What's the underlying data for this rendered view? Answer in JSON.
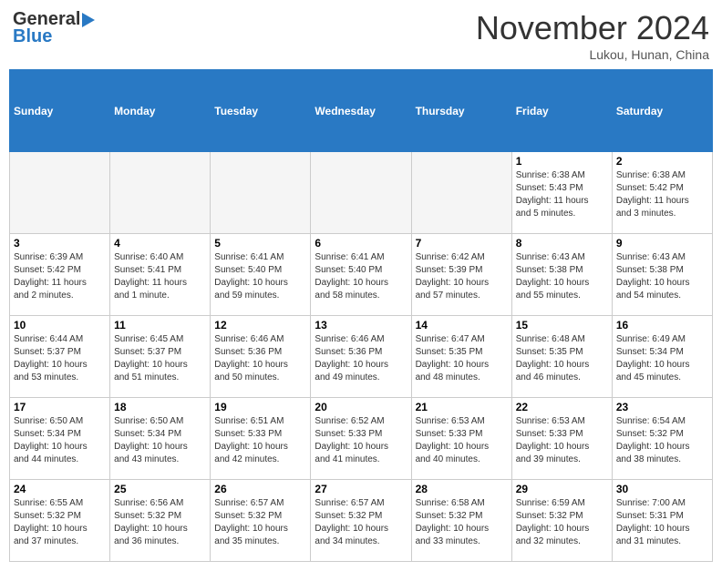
{
  "logo": {
    "line1": "General",
    "line2": "Blue"
  },
  "title": "November 2024",
  "subtitle": "Lukou, Hunan, China",
  "weekdays": [
    "Sunday",
    "Monday",
    "Tuesday",
    "Wednesday",
    "Thursday",
    "Friday",
    "Saturday"
  ],
  "weeks": [
    [
      {
        "day": "",
        "info": ""
      },
      {
        "day": "",
        "info": ""
      },
      {
        "day": "",
        "info": ""
      },
      {
        "day": "",
        "info": ""
      },
      {
        "day": "",
        "info": ""
      },
      {
        "day": "1",
        "info": "Sunrise: 6:38 AM\nSunset: 5:43 PM\nDaylight: 11 hours\nand 5 minutes."
      },
      {
        "day": "2",
        "info": "Sunrise: 6:38 AM\nSunset: 5:42 PM\nDaylight: 11 hours\nand 3 minutes."
      }
    ],
    [
      {
        "day": "3",
        "info": "Sunrise: 6:39 AM\nSunset: 5:42 PM\nDaylight: 11 hours\nand 2 minutes."
      },
      {
        "day": "4",
        "info": "Sunrise: 6:40 AM\nSunset: 5:41 PM\nDaylight: 11 hours\nand 1 minute."
      },
      {
        "day": "5",
        "info": "Sunrise: 6:41 AM\nSunset: 5:40 PM\nDaylight: 10 hours\nand 59 minutes."
      },
      {
        "day": "6",
        "info": "Sunrise: 6:41 AM\nSunset: 5:40 PM\nDaylight: 10 hours\nand 58 minutes."
      },
      {
        "day": "7",
        "info": "Sunrise: 6:42 AM\nSunset: 5:39 PM\nDaylight: 10 hours\nand 57 minutes."
      },
      {
        "day": "8",
        "info": "Sunrise: 6:43 AM\nSunset: 5:38 PM\nDaylight: 10 hours\nand 55 minutes."
      },
      {
        "day": "9",
        "info": "Sunrise: 6:43 AM\nSunset: 5:38 PM\nDaylight: 10 hours\nand 54 minutes."
      }
    ],
    [
      {
        "day": "10",
        "info": "Sunrise: 6:44 AM\nSunset: 5:37 PM\nDaylight: 10 hours\nand 53 minutes."
      },
      {
        "day": "11",
        "info": "Sunrise: 6:45 AM\nSunset: 5:37 PM\nDaylight: 10 hours\nand 51 minutes."
      },
      {
        "day": "12",
        "info": "Sunrise: 6:46 AM\nSunset: 5:36 PM\nDaylight: 10 hours\nand 50 minutes."
      },
      {
        "day": "13",
        "info": "Sunrise: 6:46 AM\nSunset: 5:36 PM\nDaylight: 10 hours\nand 49 minutes."
      },
      {
        "day": "14",
        "info": "Sunrise: 6:47 AM\nSunset: 5:35 PM\nDaylight: 10 hours\nand 48 minutes."
      },
      {
        "day": "15",
        "info": "Sunrise: 6:48 AM\nSunset: 5:35 PM\nDaylight: 10 hours\nand 46 minutes."
      },
      {
        "day": "16",
        "info": "Sunrise: 6:49 AM\nSunset: 5:34 PM\nDaylight: 10 hours\nand 45 minutes."
      }
    ],
    [
      {
        "day": "17",
        "info": "Sunrise: 6:50 AM\nSunset: 5:34 PM\nDaylight: 10 hours\nand 44 minutes."
      },
      {
        "day": "18",
        "info": "Sunrise: 6:50 AM\nSunset: 5:34 PM\nDaylight: 10 hours\nand 43 minutes."
      },
      {
        "day": "19",
        "info": "Sunrise: 6:51 AM\nSunset: 5:33 PM\nDaylight: 10 hours\nand 42 minutes."
      },
      {
        "day": "20",
        "info": "Sunrise: 6:52 AM\nSunset: 5:33 PM\nDaylight: 10 hours\nand 41 minutes."
      },
      {
        "day": "21",
        "info": "Sunrise: 6:53 AM\nSunset: 5:33 PM\nDaylight: 10 hours\nand 40 minutes."
      },
      {
        "day": "22",
        "info": "Sunrise: 6:53 AM\nSunset: 5:33 PM\nDaylight: 10 hours\nand 39 minutes."
      },
      {
        "day": "23",
        "info": "Sunrise: 6:54 AM\nSunset: 5:32 PM\nDaylight: 10 hours\nand 38 minutes."
      }
    ],
    [
      {
        "day": "24",
        "info": "Sunrise: 6:55 AM\nSunset: 5:32 PM\nDaylight: 10 hours\nand 37 minutes."
      },
      {
        "day": "25",
        "info": "Sunrise: 6:56 AM\nSunset: 5:32 PM\nDaylight: 10 hours\nand 36 minutes."
      },
      {
        "day": "26",
        "info": "Sunrise: 6:57 AM\nSunset: 5:32 PM\nDaylight: 10 hours\nand 35 minutes."
      },
      {
        "day": "27",
        "info": "Sunrise: 6:57 AM\nSunset: 5:32 PM\nDaylight: 10 hours\nand 34 minutes."
      },
      {
        "day": "28",
        "info": "Sunrise: 6:58 AM\nSunset: 5:32 PM\nDaylight: 10 hours\nand 33 minutes."
      },
      {
        "day": "29",
        "info": "Sunrise: 6:59 AM\nSunset: 5:32 PM\nDaylight: 10 hours\nand 32 minutes."
      },
      {
        "day": "30",
        "info": "Sunrise: 7:00 AM\nSunset: 5:31 PM\nDaylight: 10 hours\nand 31 minutes."
      }
    ]
  ]
}
